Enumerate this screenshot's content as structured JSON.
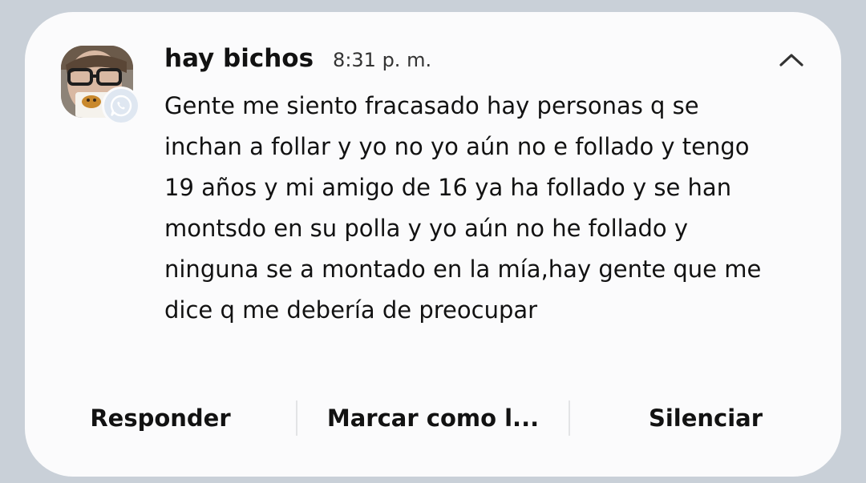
{
  "notification": {
    "app_icon": "whatsapp-icon",
    "sender": "hay bichos",
    "time": "8:31 p. m.",
    "message": "Gente me siento fracasado hay personas q se inchan a follar y yo no yo aún no e follado y tengo 19 años y mi amigo de 16 ya ha follado y se han montsdo en su polla y yo aún no he follado y ninguna se a montado en la mía,hay gente que me dice q me debería de preocupar",
    "collapse_icon": "chevron-up-icon"
  },
  "actions": {
    "reply": "Responder",
    "mark_read": "Marcar como l...",
    "mute": "Silenciar"
  },
  "colors": {
    "background": "#c9d0d8",
    "card": "#fbfbfc",
    "text": "#121212",
    "badge": "#dfe7f1"
  }
}
